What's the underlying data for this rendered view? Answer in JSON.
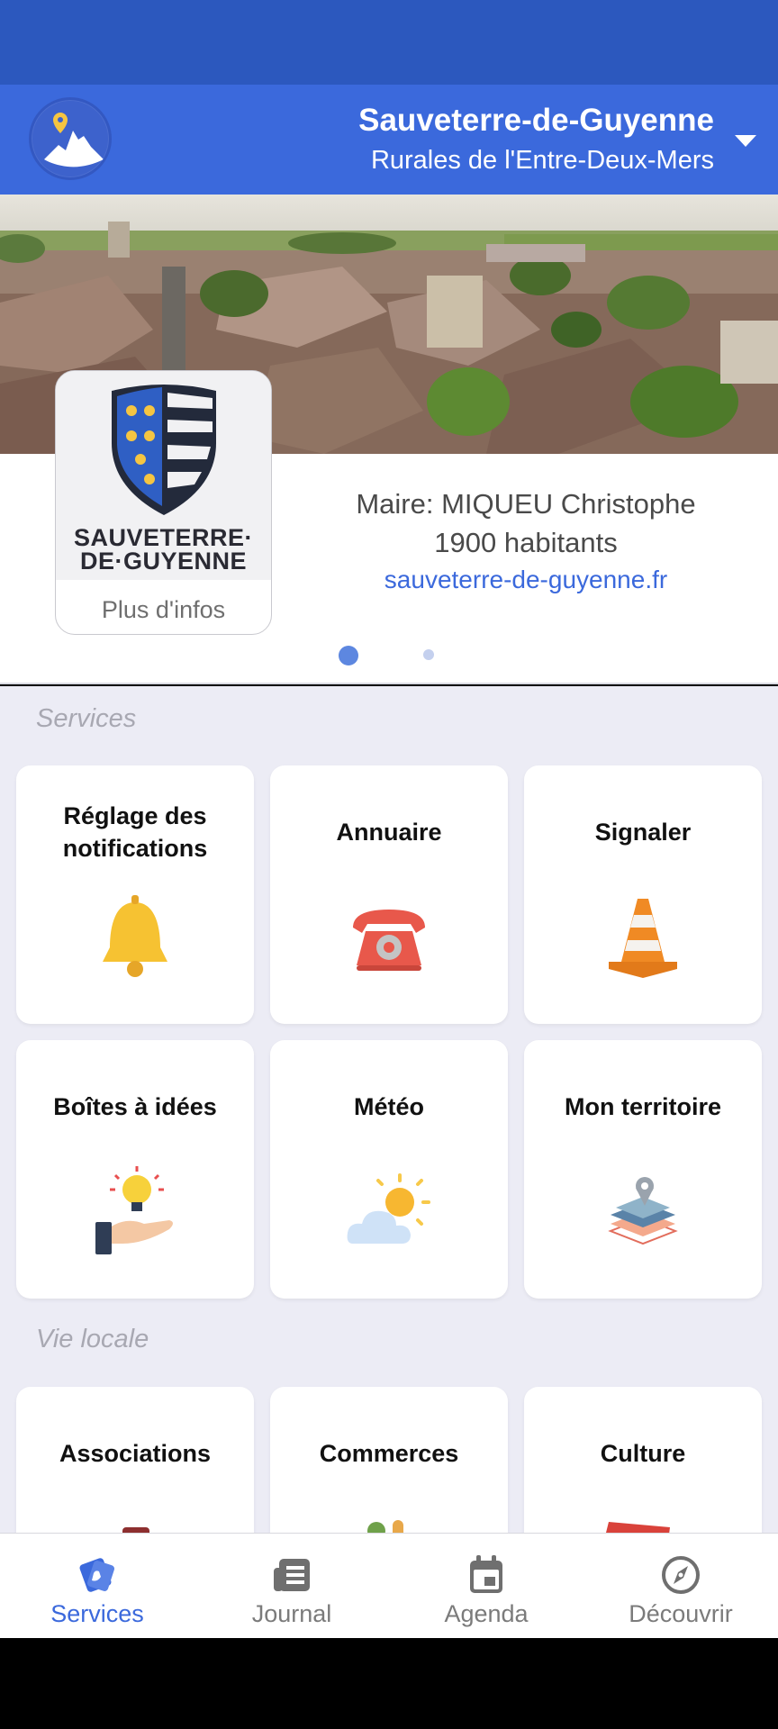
{
  "colors": {
    "status_bar": "#2c58be",
    "header": "#3b69dc",
    "accent": "#3b69dc",
    "background": "#ececf5"
  },
  "header": {
    "title": "Sauveterre-de-Guyenne",
    "subtitle": "Rurales de l'Entre-Deux-Mers",
    "logo_icon": "town-pin-logo-icon",
    "menu_icon": "chevron-down-icon"
  },
  "banner": {
    "image": "village-aerial-photo"
  },
  "commune": {
    "crest_text_line1": "SAUVETERRE·",
    "crest_text_line2": "DE·GUYENNE",
    "more_info": "Plus d'infos",
    "mayor": "Maire: MIQUEU Christophe",
    "population": "1900 habitants",
    "website": "sauveterre-de-guyenne.fr",
    "carousel": {
      "pages": 2,
      "current": 1
    }
  },
  "sections": [
    {
      "title": "Services",
      "tiles": [
        {
          "label": "Réglage des notifications",
          "icon": "bell-icon"
        },
        {
          "label": "Annuaire",
          "icon": "telephone-icon"
        },
        {
          "label": "Signaler",
          "icon": "traffic-cone-icon"
        },
        {
          "label": "Boîtes à idées",
          "icon": "lightbulb-hand-icon"
        },
        {
          "label": "Météo",
          "icon": "sun-cloud-icon"
        },
        {
          "label": "Mon territoire",
          "icon": "map-layers-icon"
        }
      ]
    },
    {
      "title": "Vie locale",
      "tiles": [
        {
          "label": "Associations",
          "icon": "associations-icon"
        },
        {
          "label": "Commerces",
          "icon": "shopping-bag-icon"
        },
        {
          "label": "Culture",
          "icon": "culture-icon"
        }
      ]
    }
  ],
  "bottom_nav": [
    {
      "label": "Services",
      "icon": "services-icon",
      "active": true
    },
    {
      "label": "Journal",
      "icon": "newspaper-icon",
      "active": false
    },
    {
      "label": "Agenda",
      "icon": "calendar-icon",
      "active": false
    },
    {
      "label": "Découvrir",
      "icon": "compass-icon",
      "active": false
    }
  ]
}
